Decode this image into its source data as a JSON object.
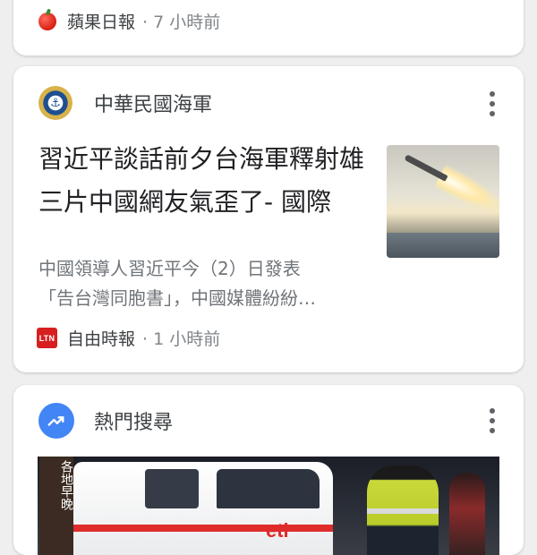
{
  "card_top": {
    "source": "蘋果日報",
    "time": "· 7 小時前"
  },
  "card_news": {
    "publisher": "中華民國海軍",
    "headline": "習近平談話前夕台海軍釋射雄三片中國網友氣歪了- 國際",
    "snippet_line1": "中國領導人習近平今（2）日發表",
    "snippet_line2": "「告台灣同胞書」，中國媒體紛紛…",
    "source_logo": "LTN",
    "source": "自由時報",
    "time": "· 1 小時前"
  },
  "card_trend": {
    "title": "熱門搜尋",
    "image_side_text": "各地早晚"
  },
  "colors": {
    "background": "#efefef",
    "card": "#ffffff",
    "trend_icon": "#4285f4",
    "ltn_red": "#d71f1f"
  },
  "icons": [
    "apple-icon",
    "navy-emblem-icon",
    "more-vert-icon",
    "ltn-logo-icon",
    "trending-up-icon"
  ]
}
